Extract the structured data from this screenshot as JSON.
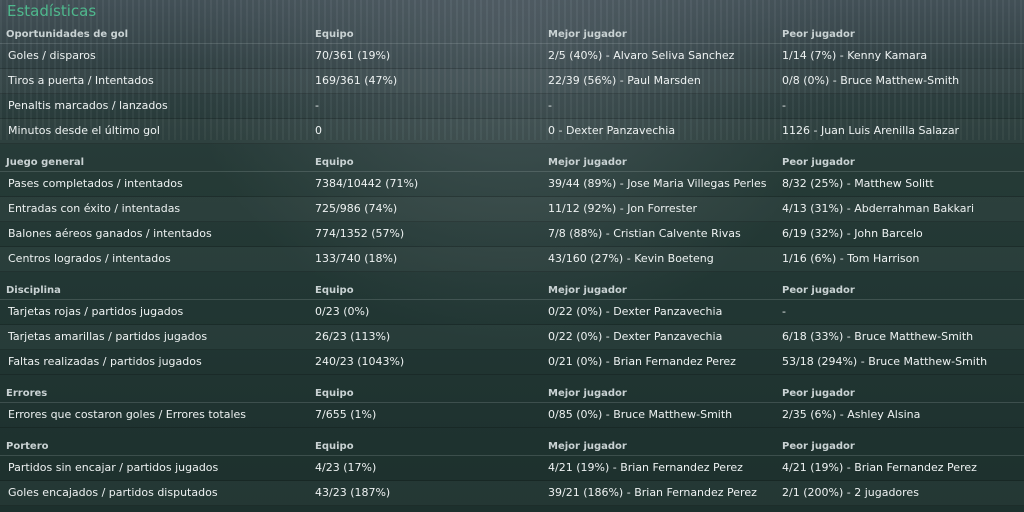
{
  "title": "Estadísticas",
  "sections": [
    {
      "header": [
        "Oportunidades de gol",
        "Equipo",
        "Mejor jugador",
        "Peor jugador"
      ],
      "rows": [
        [
          "Goles / disparos",
          "70/361 (19%)",
          "2/5 (40%) - Alvaro Seliva Sanchez",
          "1/14 (7%) - Kenny Kamara"
        ],
        [
          "Tiros a puerta / Intentados",
          "169/361 (47%)",
          "22/39 (56%) - Paul Marsden",
          "0/8 (0%) - Bruce Matthew-Smith"
        ],
        [
          "Penaltis marcados / lanzados",
          "-",
          "-",
          "-"
        ],
        [
          "Minutos desde el último gol",
          "0",
          "0 - Dexter Panzavechia",
          "1126 - Juan Luis Arenilla Salazar"
        ]
      ]
    },
    {
      "header": [
        "Juego general",
        "Equipo",
        "Mejor jugador",
        "Peor jugador"
      ],
      "rows": [
        [
          "Pases completados / intentados",
          "7384/10442 (71%)",
          "39/44 (89%) - Jose Maria Villegas Perles",
          "8/32 (25%) - Matthew Solitt"
        ],
        [
          "Entradas con éxito / intentadas",
          "725/986 (74%)",
          "11/12 (92%) - Jon Forrester",
          "4/13 (31%) - Abderrahman Bakkari"
        ],
        [
          "Balones aéreos ganados / intentados",
          "774/1352 (57%)",
          "7/8 (88%) - Cristian Calvente Rivas",
          "6/19 (32%) - John Barcelo"
        ],
        [
          "Centros logrados / intentados",
          "133/740 (18%)",
          "43/160 (27%) - Kevin Boeteng",
          "1/16 (6%) - Tom Harrison"
        ]
      ]
    },
    {
      "header": [
        "Disciplina",
        "Equipo",
        "Mejor jugador",
        "Peor jugador"
      ],
      "rows": [
        [
          "Tarjetas rojas / partidos jugados",
          "0/23 (0%)",
          "0/22 (0%) - Dexter Panzavechia",
          "-"
        ],
        [
          "Tarjetas amarillas / partidos jugados",
          "26/23 (113%)",
          "0/22 (0%) - Dexter Panzavechia",
          "6/18 (33%) - Bruce Matthew-Smith"
        ],
        [
          "Faltas realizadas / partidos jugados",
          "240/23 (1043%)",
          "0/21 (0%) - Brian Fernandez Perez",
          "53/18 (294%) - Bruce Matthew-Smith"
        ]
      ]
    },
    {
      "header": [
        "Errores",
        "Equipo",
        "Mejor jugador",
        "Peor jugador"
      ],
      "rows": [
        [
          "Errores que costaron goles / Errores totales",
          "7/655 (1%)",
          "0/85 (0%) - Bruce Matthew-Smith",
          "2/35 (6%) - Ashley Alsina"
        ]
      ]
    },
    {
      "header": [
        "Portero",
        "Equipo",
        "Mejor jugador",
        "Peor jugador"
      ],
      "rows": [
        [
          "Partidos sin encajar / partidos jugados",
          "4/23 (17%)",
          "4/21 (19%) - Brian Fernandez Perez",
          "4/21 (19%) - Brian Fernandez Perez"
        ],
        [
          "Goles encajados / partidos disputados",
          "43/23 (187%)",
          "39/21 (186%) - Brian Fernandez Perez",
          "2/1 (200%) - 2 jugadores"
        ]
      ]
    }
  ]
}
